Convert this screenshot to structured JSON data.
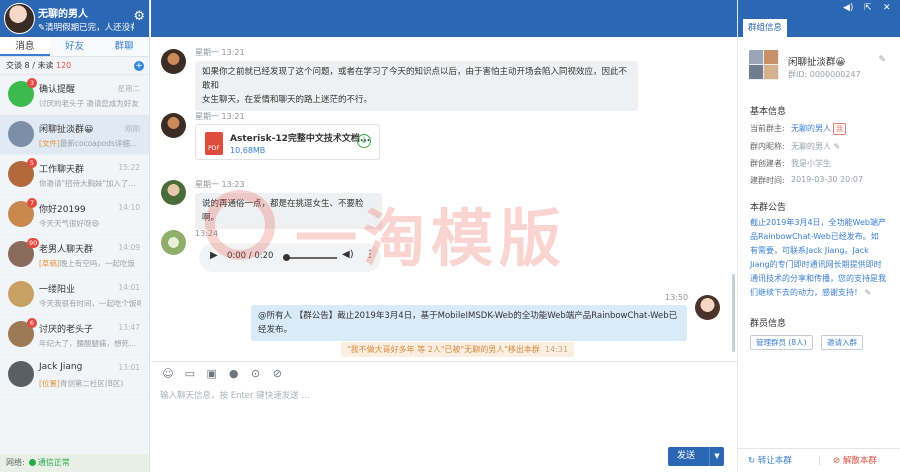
{
  "profile": {
    "name": "无聊的男人",
    "signature": "清明假期已完，人还没有..."
  },
  "tabs": [
    "消息",
    "好友",
    "群聊"
  ],
  "sessions": {
    "label": "交谈",
    "count": "8",
    "unread_label": "未读",
    "unread_count": "120"
  },
  "conversations": [
    {
      "title": "确认提醒",
      "time": "星期二",
      "preview": "讨厌的老头子 邀请您成为好友",
      "badge": "3",
      "tag": "",
      "color": "#3dba4e"
    },
    {
      "title": "闲聊扯淡群😀",
      "time": "刚刚",
      "preview": "最新cocoapods详细...",
      "badge": "",
      "tag": "[文件]",
      "color": "#7d8fa8"
    },
    {
      "title": "工作聊天群",
      "time": "15:22",
      "preview": "你邀请\"招待大胸妹\"加入了...",
      "badge": "5",
      "tag": "",
      "color": "#b26a3c"
    },
    {
      "title": "你好20199",
      "time": "14:10",
      "preview": "今天天气很好呀😄",
      "badge": "7",
      "tag": "",
      "color": "#c9884e"
    },
    {
      "title": "老男人聊天群",
      "time": "14:09",
      "preview": "晚上有空吗，一起吃饭",
      "badge": "90",
      "tag": "[草稿]",
      "color": "#8a6a5a"
    },
    {
      "title": "一缕阳业",
      "time": "14:01",
      "preview": "今天我很有时间，一起吃个饭吧",
      "badge": "",
      "tag": "",
      "color": "#c8a063"
    },
    {
      "title": "讨厌的老头子",
      "time": "13:47",
      "preview": "年纪大了，腰酸腿痛，想死...",
      "badge": "6",
      "tag": "",
      "color": "#9c7a55"
    },
    {
      "title": "Jack Jiang",
      "time": "13:01",
      "preview": "青剑第二社区(B区)",
      "badge": "",
      "tag": "[位置]",
      "color": "#5a5f66"
    }
  ],
  "network": {
    "label": "网络:",
    "status": "通信正常"
  },
  "messages": {
    "m1": {
      "sender": "星期一 13:21",
      "text_line1": "如果你之前就已经发现了这个问题，或者在学习了今天的知识点以后，由于害怕主动开场会陷入同视效应，因此不敢和",
      "text_line2": "女生聊天，在爱情和聊天的路上迷茫的不行。"
    },
    "m2": {
      "sender": "星期一 13:21",
      "file_name": "Asterisk-12完整中文技术文档...",
      "file_size": "10.68MB"
    },
    "m3": {
      "sender": "星期一 13:23",
      "text": "说的再通俗一点，都是在挑逗女生、不要脸啊。"
    },
    "m4": {
      "sender": "13:24",
      "audio_time": "0:00 / 0:20"
    },
    "m5": {
      "time": "13:50",
      "text": "@所有人 【群公告】截止2019年3月4日，基于MobileIMSDK-Web的全功能Web端产品RainbowChat-Web已经发布。"
    },
    "sys": {
      "text": "\"我不做大哥好多年 等 2人\"已被\"无聊的男人\"移出本群",
      "time": "14:31"
    }
  },
  "input": {
    "placeholder": "输入聊天信息，按 Enter 键快速发送 ...",
    "send": "发送"
  },
  "group": {
    "tab": "群组信息",
    "name": "闲聊扯淡群😀",
    "id": "群ID: 0000000247",
    "basic_title": "基本信息",
    "owner_label": "当前群主:",
    "owner": "无聊的男人",
    "owner_tag": "我",
    "nick_label": "群内昵称:",
    "nick": "无聊的男人",
    "creator_label": "群创建者:",
    "creator": "我是小学生",
    "created_label": "建群时间:",
    "created": "2019-03-30 20:07",
    "notice_title": "本群公告",
    "notice": "截止2019年3月4日，全功能Web端产品RainbowChat-Web已经发布。如有需要，可联系Jack Jiang。Jack Jiang的专门即时通讯网长期提供即时通讯技术的分享和传播，您的支持是我们继续下去的动力，感谢支持！",
    "members_title": "群员信息",
    "manage": "管理群员 (8人)",
    "invite": "邀请入群",
    "transfer": "转让本群",
    "dissolve": "解散本群"
  },
  "watermark": "一淘模版"
}
